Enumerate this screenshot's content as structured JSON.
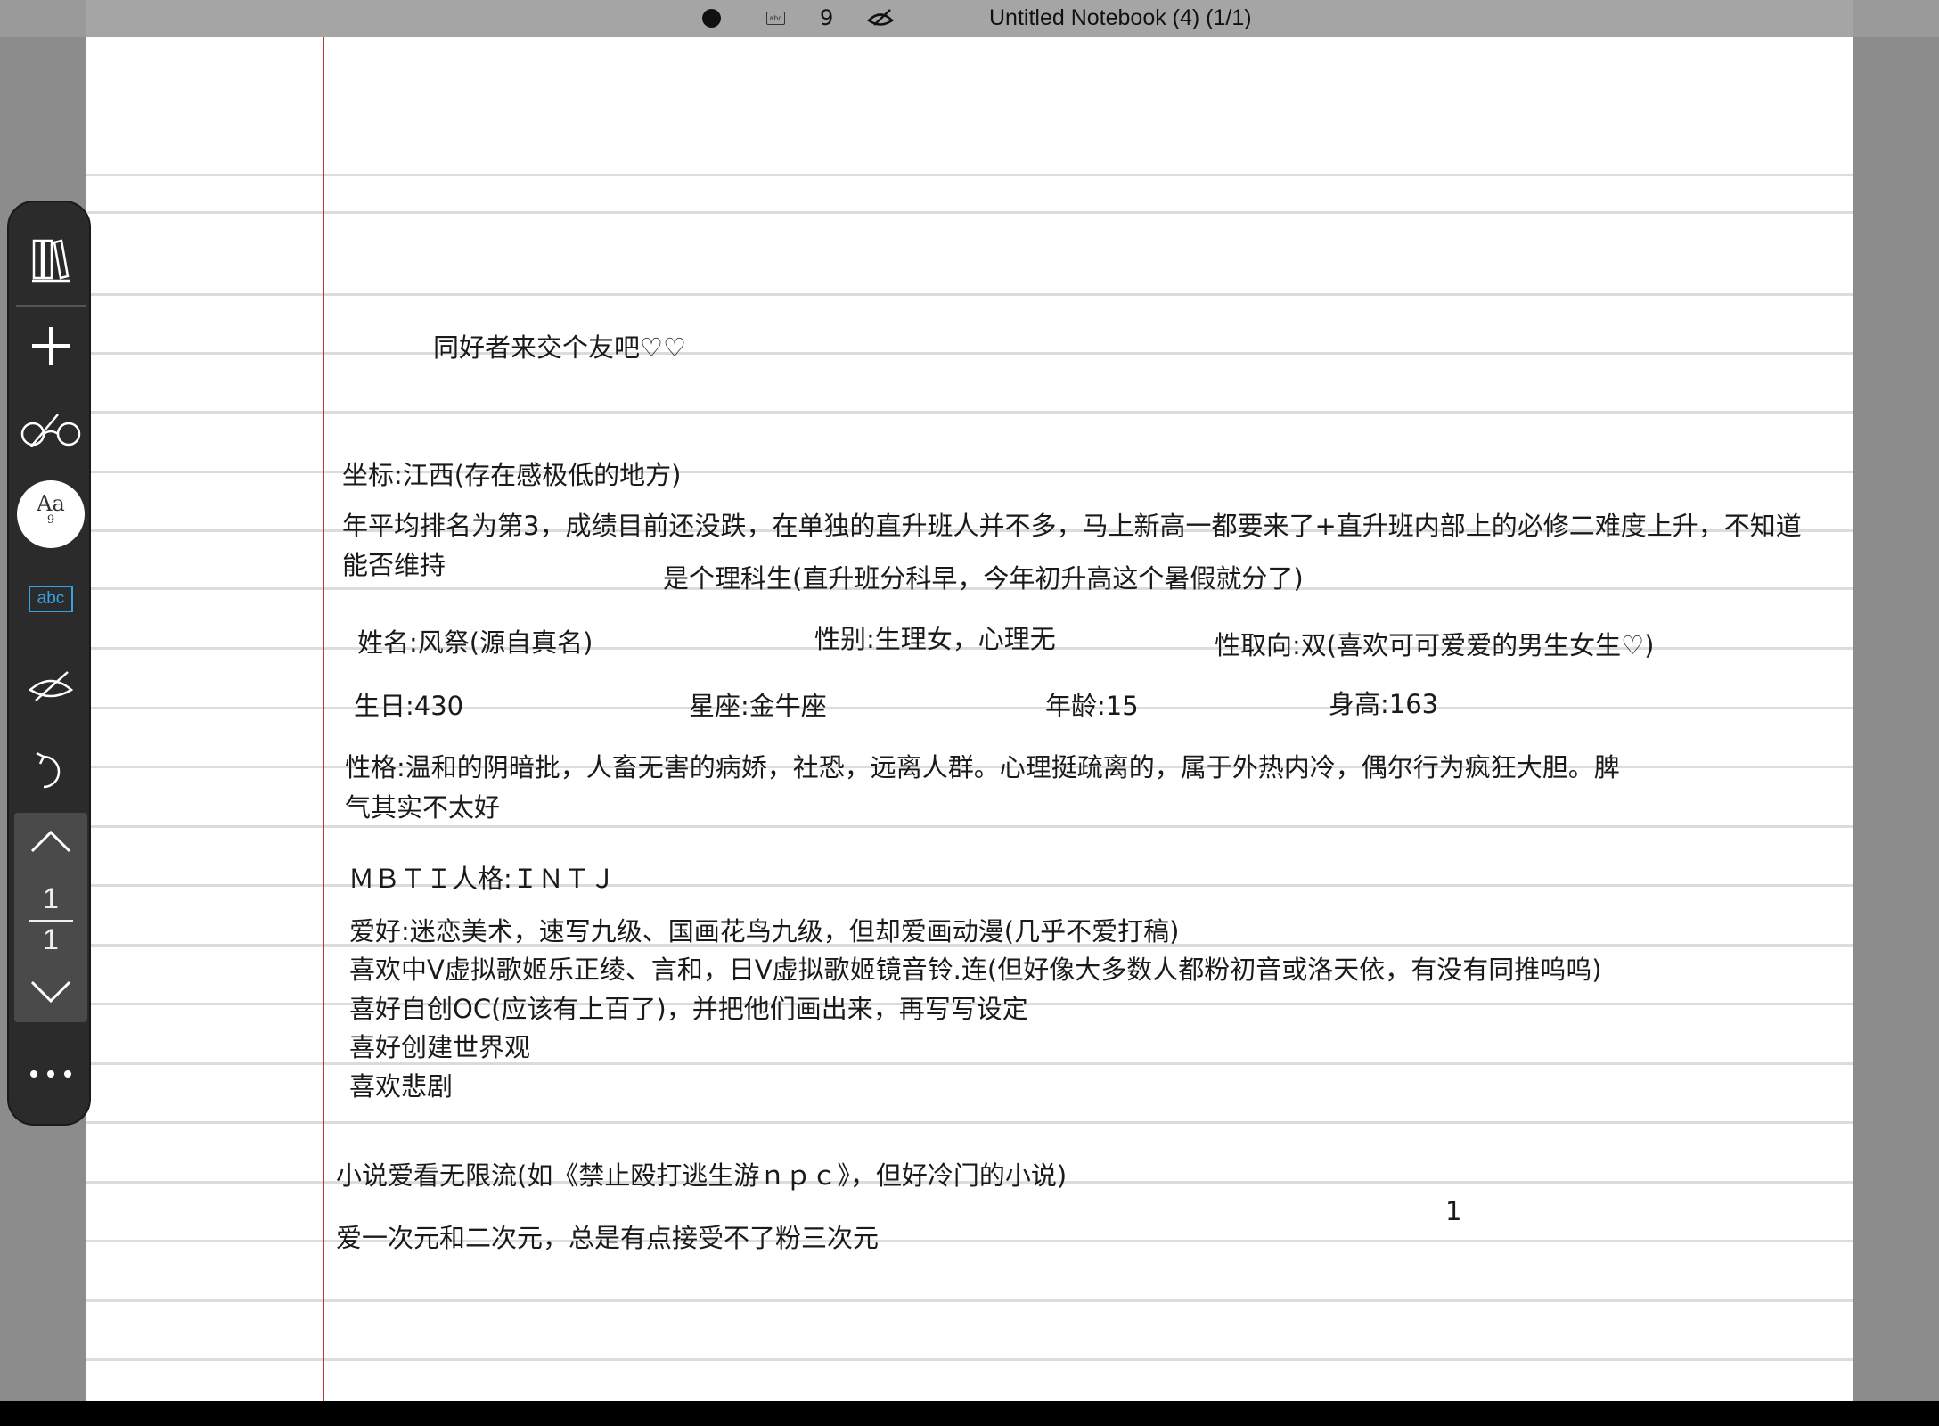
{
  "topbar": {
    "status_icons": [
      "pen-dot-icon",
      "abc-icon",
      "hide-keyboard-icon"
    ],
    "font_size": "9",
    "title": "Untitled Notebook (4) (1/1)"
  },
  "toolbar": {
    "icons": [
      "library-icon",
      "add-icon",
      "glasses-icon",
      "font-icon",
      "abc-icon",
      "hide-handwriting-icon",
      "undo-icon",
      "page-up-icon",
      "page-down-icon",
      "more-icon"
    ],
    "font_label": "Aa",
    "font_size": "9",
    "abc_label": "abc",
    "page_current": "1",
    "page_total": "1",
    "accent_color": "#3aa0e6"
  },
  "note": {
    "heading": "同好者来交个友吧♡♡",
    "location": "坐标:江西(存在感极低的地方)",
    "rank_line1": "年平均排名为第3，成绩目前还没跌，在单独的直升班人并不多，马上新高一都要来了+直升班内部上的必修二难度上升，不知道",
    "rank_line2": "能否维持",
    "science": "是个理科生(直升班分科早，今年初升高这个暑假就分了)",
    "name": "姓名:风祭(源自真名)",
    "gender": "性别:生理女，心理无",
    "orientation": "性取向:双(喜欢可可爱爱的男生女生♡)",
    "birthday": "生日:430",
    "zodiac": "星座:金牛座",
    "age": "年龄:15",
    "height": "身高:163",
    "personality_line1": "性格:温和的阴暗批，人畜无害的病娇，社恐，远离人群。心理挺疏离的，属于外热内冷，偶尔行为疯狂大胆。脾",
    "personality_line2": "气其实不太好",
    "mbti": "ＭＢＴＩ人格:ＩＮＴＪ",
    "hobbies": [
      "爱好:迷恋美术，速写九级、国画花鸟九级，但却爱画动漫(几乎不爱打稿)",
      "喜欢中V虚拟歌姬乐正绫、言和，日V虚拟歌姬镜音铃.连(但好像大多数人都粉初音或洛天依，有没有同推呜呜)",
      "喜好自创OC(应该有上百了)，并把他们画出来，再写写设定",
      "喜好创建世界观",
      "喜欢悲剧"
    ],
    "novels": "小说爱看无限流(如《禁止殴打逃生游ｎｐｃ》，但好冷门的小说)",
    "dimensions": "爱一次元和二次元，总是有点接受不了粉三次元",
    "stray_mark": "1"
  },
  "colors": {
    "margin_line": "#b03a3a",
    "ruled_line": "#dcdcdc",
    "toolbar_bg": "#2b2b2b"
  }
}
